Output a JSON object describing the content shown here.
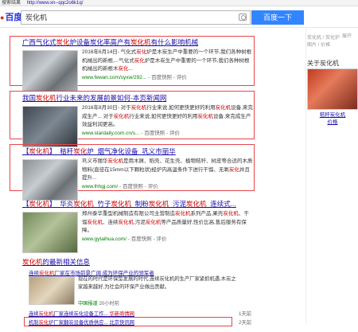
{
  "browser": {
    "title": "搜索结果",
    "url": "http://www.xn--qqc2o6k1q/"
  },
  "header": {
    "logo_text": "百度",
    "search_value": "炭化机",
    "search_button": "百度一下"
  },
  "results": [
    {
      "title_pre": "",
      "title_parts": [
        "广西气化式",
        "炭化",
        "炉设备炭化率高产有",
        "炭化机",
        "有什么影响机械"
      ],
      "date": "2016年6月14日",
      "desc_parts": [
        "- 气化式",
        "炭化",
        "炉是木炭生产中重要的一个环节,我们各种树根机械出的新根,...气化式",
        "炭化",
        "炉是木炭生产中重要的一个环节,我们各种树根机械出的新根木",
        "炭化",
        "..."
      ],
      "url": "www.fewan.com/syxw/292...",
      "cache": "- 百度快照 - 评价"
    },
    {
      "title_parts": [
        "我国",
        "炭化机",
        "行业未来的发展前景如何-本页新闻网"
      ],
      "date": "2016年8月30日",
      "desc_parts": [
        "- 对于",
        "炭化机",
        "行业来说,如何更快更好的利用",
        "炭化机",
        "设备,来完成生产... 对于",
        "炭化机",
        "行业来说,如何更快更好的利用",
        "炭化机",
        "设备,来完成生产效益利润更高。"
      ],
      "url": "www.stardaily.com.cn/s...",
      "cache": "- 百度快照 - 评价"
    },
    {
      "title_parts": [
        "【",
        "炭化机",
        "】_秸秆",
        "炭化",
        "炉_烟气净化设备_巩义市丽华"
      ],
      "date": "",
      "desc_parts": [
        "巩义市丽华",
        "炭化机",
        "是用木屑、稻壳、花生壳、植物秸秆、树皮等合适的木质物料(直径在15mm以下颗粒状)经炉内高温条件下进行干馏、无氧",
        "炭化",
        "并且提升..."
      ],
      "url": "www.lhhgj.com/",
      "cache": "- 百度快照 - 评价"
    },
    {
      "title_parts": [
        "【",
        "炭化机",
        "】_华炎",
        "炭化机",
        "_竹子",
        "炭化机",
        "_制粉",
        "炭化机",
        "_污泥",
        "炭化机",
        "_连续式..."
      ],
      "date": "",
      "desc_parts": [
        "郑州泰华重型机械制造有限公司主营制造",
        "炭化机",
        "系列产品,果壳",
        "炭化机",
        "、干馏",
        "炭化机",
        "、连续",
        "炭化机",
        ",污泥",
        "炭化机",
        "等产品质量好,性价比高,售后服务有保障。"
      ],
      "url": "www.gytaihua.com/",
      "cache": "- 百度快照 - 评价"
    }
  ],
  "news": {
    "heading_pre": "炭化机",
    "heading_post": "的最新相关信息",
    "top_title_parts": [
      "连续",
      "炭化机",
      "厂家在市场前景广阔 成为环保产业的领军者"
    ],
    "top_desc": "现在的时代是环保型发展的时代,连续炭化机的生产厂家紧抓机遇,木炭之家越来越好,为社会的环保产业做出贡献。",
    "top_source": "中国报道",
    "top_time": "20小时前",
    "items": [
      {
        "parts": [
          "连续",
          "炭化机",
          "厂家连续炭化设备工作...",
          " 华新商情网"
        ],
        "time": "1天前"
      },
      {
        "parts": [
          "机制",
          "炭化",
          "炉厂家翻炭设备优质供应",
          "...",
          " 北京快讯网"
        ],
        "time": "2天前"
      }
    ]
  },
  "sidebar": {
    "top_link": "展开",
    "tags": "炭化机 / 炭化炉\n图片 / 价格",
    "heading": "关于炭化机",
    "caption": "秸秆炭化机\n价格"
  }
}
